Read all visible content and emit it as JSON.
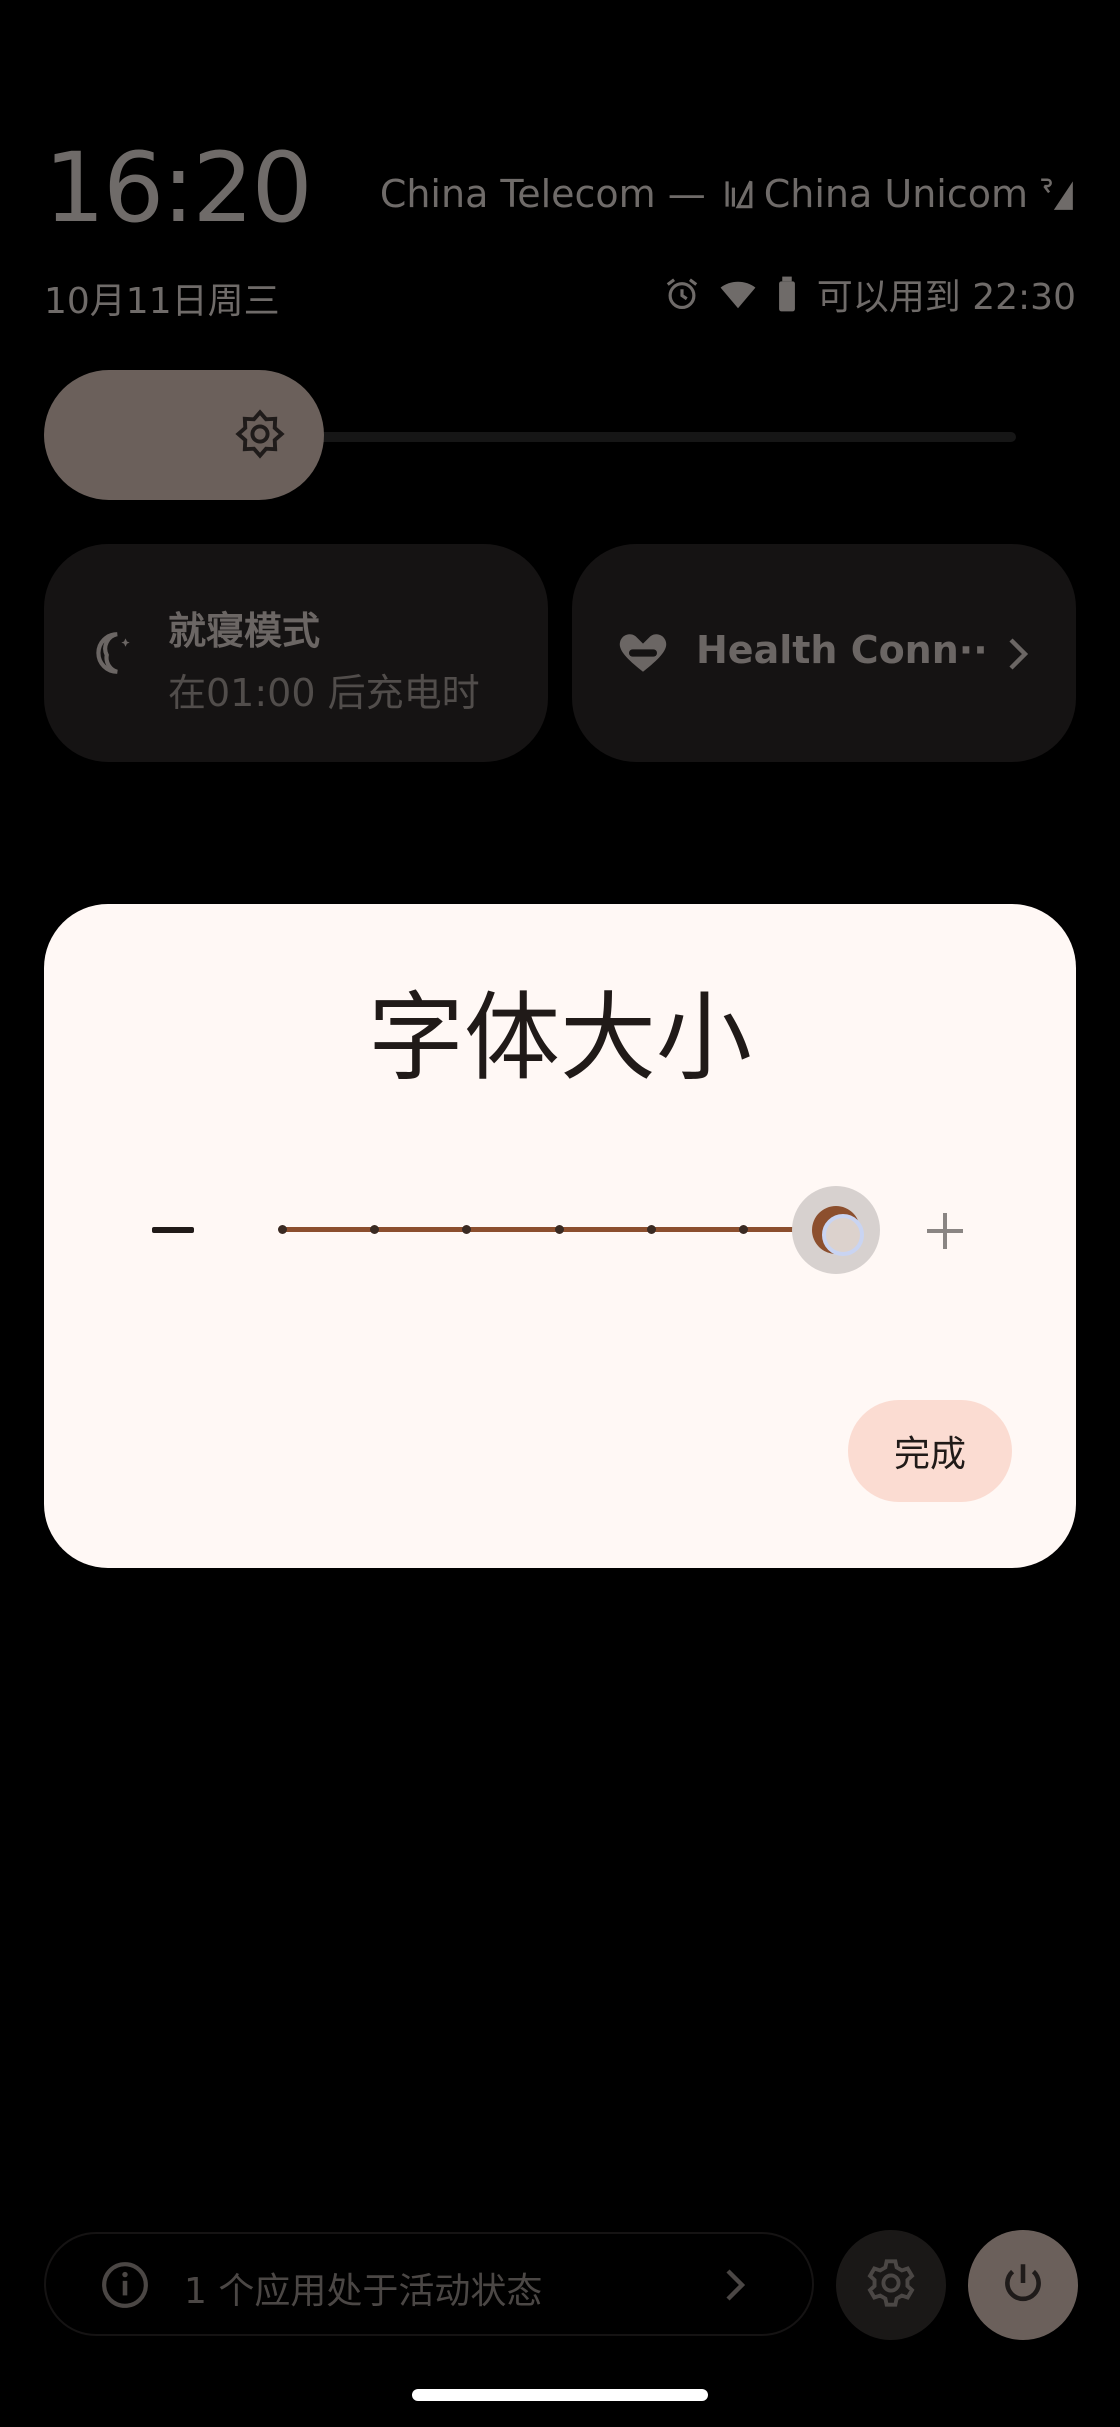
{
  "status": {
    "time": "16:20",
    "date": "10月11日周三",
    "carrier1": "China Telecom —",
    "carrier2": "China Unicom",
    "battery_text": "可以用到 22:30",
    "icons": [
      "alarm-icon",
      "wifi-icon",
      "battery-icon",
      "signal-icon"
    ]
  },
  "quick_settings": {
    "brightness_icon": "brightness-icon",
    "tiles": [
      {
        "title": "就寝模式",
        "subtitle": "在01:00 后充电时",
        "icon": "bedtime-moon-icon"
      },
      {
        "title": "Health Conn··",
        "icon": "health-connect-icon"
      }
    ]
  },
  "dialog": {
    "title": "字体大小",
    "slider": {
      "steps": 7,
      "value_index": 6
    },
    "done_label": "完成"
  },
  "dialog_peek": "↑",
  "footer": {
    "active_apps_text": "1 个应用处于活动状态"
  },
  "colors": {
    "accent": "#8c4f2e",
    "dialog_bg": "#fff8f5",
    "done_button_bg": "#fbdcd2",
    "tile_bg": "#151313"
  }
}
